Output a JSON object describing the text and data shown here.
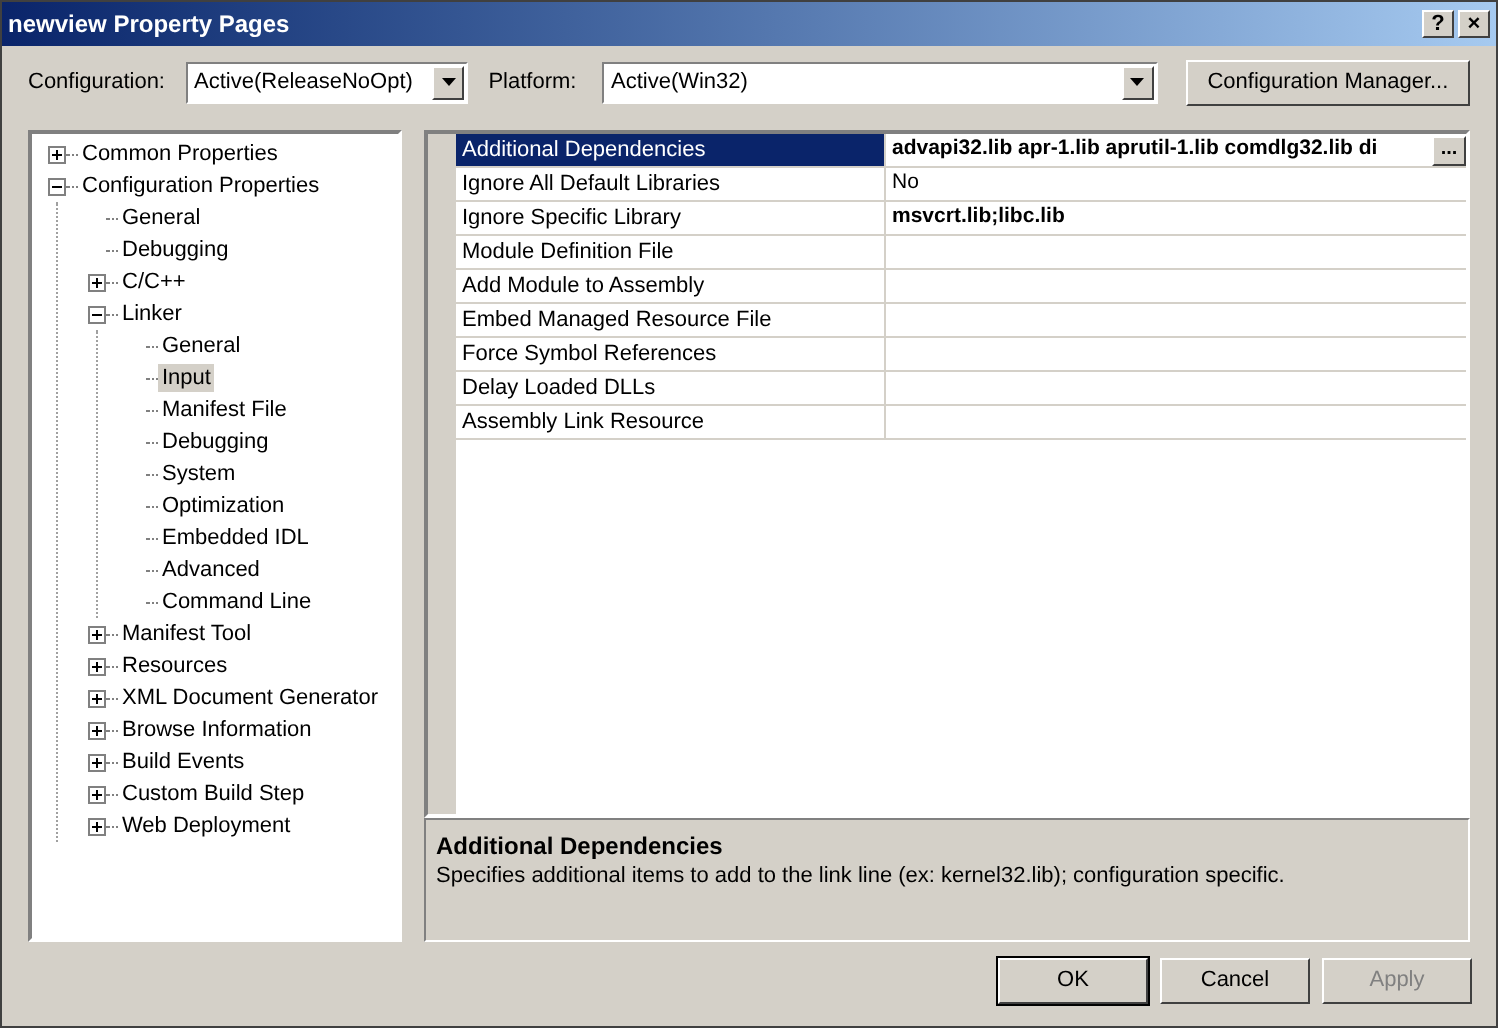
{
  "window": {
    "title": "newview Property Pages",
    "buttons": [
      "?",
      "×"
    ]
  },
  "configuration": {
    "label": "Configuration:",
    "value": "Active(ReleaseNoOpt)"
  },
  "platform": {
    "label": "Platform:",
    "value": "Active(Win32)"
  },
  "config_manager_button": "Configuration Manager...",
  "tree": [
    {
      "label": "Common Properties",
      "expanded": false,
      "selected": false
    },
    {
      "label": "Configuration Properties",
      "expanded": true,
      "selected": false,
      "children": [
        {
          "label": "General",
          "selected": false
        },
        {
          "label": "Debugging",
          "selected": false
        },
        {
          "label": "C/C++",
          "expanded": false,
          "selected": false
        },
        {
          "label": "Linker",
          "expanded": true,
          "selected": false,
          "children": [
            {
              "label": "General",
              "selected": false
            },
            {
              "label": "Input",
              "selected": true
            },
            {
              "label": "Manifest File",
              "selected": false
            },
            {
              "label": "Debugging",
              "selected": false
            },
            {
              "label": "System",
              "selected": false
            },
            {
              "label": "Optimization",
              "selected": false
            },
            {
              "label": "Embedded IDL",
              "selected": false
            },
            {
              "label": "Advanced",
              "selected": false
            },
            {
              "label": "Command Line",
              "selected": false
            }
          ]
        },
        {
          "label": "Manifest Tool",
          "expanded": false,
          "selected": false
        },
        {
          "label": "Resources",
          "expanded": false,
          "selected": false
        },
        {
          "label": "XML Document Generator",
          "expanded": false,
          "selected": false
        },
        {
          "label": "Browse Information",
          "expanded": false,
          "selected": false
        },
        {
          "label": "Build Events",
          "expanded": false,
          "selected": false
        },
        {
          "label": "Custom Build Step",
          "expanded": false,
          "selected": false
        },
        {
          "label": "Web Deployment",
          "expanded": false,
          "selected": false
        }
      ]
    }
  ],
  "properties": [
    {
      "name": "Additional Dependencies",
      "value": "advapi32.lib apr-1.lib aprutil-1.lib comdlg32.lib di",
      "modified": true,
      "selected": true,
      "browse_button": "..."
    },
    {
      "name": "Ignore All Default Libraries",
      "value": "No",
      "modified": false,
      "selected": false
    },
    {
      "name": "Ignore Specific Library",
      "value": "msvcrt.lib;libc.lib",
      "modified": true,
      "selected": false
    },
    {
      "name": "Module Definition File",
      "selected": false
    },
    {
      "name": "Add Module to Assembly",
      "selected": false
    },
    {
      "name": "Embed Managed Resource File",
      "selected": false
    },
    {
      "name": "Force Symbol References",
      "selected": false
    },
    {
      "name": "Delay Loaded DLLs",
      "selected": false
    },
    {
      "name": "Assembly Link Resource",
      "selected": false
    }
  ],
  "description": {
    "title": "Additional Dependencies",
    "text": "Specifies additional items to add to the link line (ex: kernel32.lib); configuration specific."
  },
  "buttons": [
    {
      "label": "OK",
      "disabled": false,
      "default": true
    },
    {
      "label": "Cancel",
      "disabled": false,
      "default": false
    },
    {
      "label": "Apply",
      "disabled": true,
      "default": false
    }
  ]
}
